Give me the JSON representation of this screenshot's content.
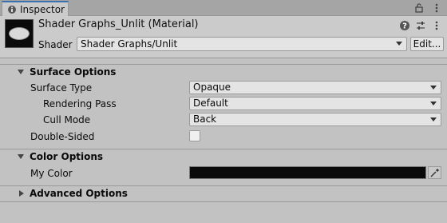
{
  "tab": {
    "label": "Inspector",
    "icon": "info-icon"
  },
  "tab_icons": [
    "lock-icon",
    "kebab-menu-icon"
  ],
  "header": {
    "title": "Shader Graphs_Unlit (Material)",
    "shader_label": "Shader",
    "shader_value": "Shader Graphs/Unlit",
    "edit_label": "Edit...",
    "icons": [
      "help-icon",
      "preset-sliders-icon",
      "kebab-menu-icon"
    ]
  },
  "sections": {
    "surface": {
      "title": "Surface Options",
      "expanded": true,
      "surface_type": {
        "label": "Surface Type",
        "value": "Opaque"
      },
      "rendering_pass": {
        "label": "Rendering Pass",
        "value": "Default"
      },
      "cull_mode": {
        "label": "Cull Mode",
        "value": "Back"
      },
      "double_sided": {
        "label": "Double-Sided",
        "checked": false
      }
    },
    "color": {
      "title": "Color Options",
      "expanded": true,
      "my_color": {
        "label": "My Color",
        "value": "#0a0a0a"
      }
    },
    "advanced": {
      "title": "Advanced Options",
      "expanded": false
    }
  },
  "colors": {
    "tab_accent": "#3a72b0",
    "panel_bg": "#c2c2c2",
    "field_bg": "#e4e4e4"
  }
}
